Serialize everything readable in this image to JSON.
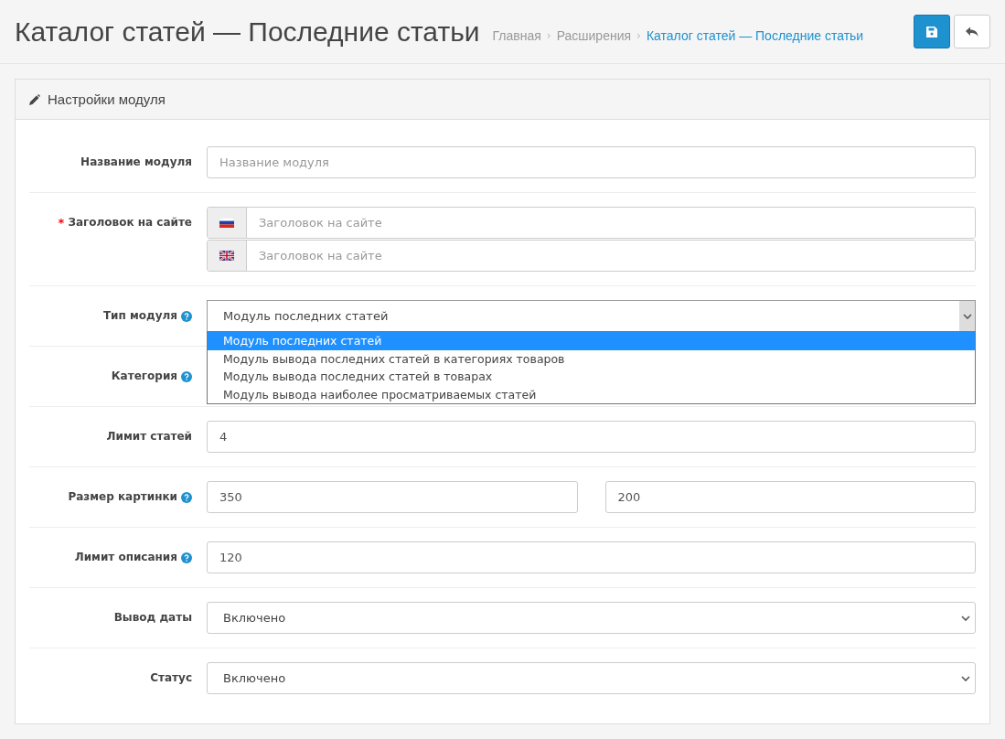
{
  "header": {
    "title": "Каталог статей — Последние статьи",
    "separator": "›",
    "breadcrumbs": [
      {
        "label": "Главная",
        "current": false
      },
      {
        "label": "Расширения",
        "current": false
      },
      {
        "label": "Каталог статей — Последние статьи",
        "current": true
      }
    ]
  },
  "panel": {
    "title": "Настройки модуля"
  },
  "rows": [
    {
      "kind": "input",
      "label": "Название модуля",
      "help": false,
      "placeholder": "Название модуля"
    },
    {
      "kind": "multilang",
      "label": "Заголовок на сайте",
      "required_mark": "*",
      "help": false,
      "fields": [
        {
          "kind": "ru",
          "placeholder": "Заголовок на сайте"
        },
        {
          "kind": "gb",
          "placeholder": "Заголовок на сайте"
        }
      ]
    },
    {
      "kind": "select_open",
      "label": "Тип модуля",
      "help": true,
      "value": "Модуль последних статей",
      "options": [
        {
          "label": "Модуль последних статей",
          "selected": true
        },
        {
          "label": "Модуль вывода последних статей в категориях товаров",
          "selected": false
        },
        {
          "label": "Модуль вывода последних статей в товарах",
          "selected": false
        },
        {
          "label": "Модуль вывода наиболее просматриваемых статей",
          "selected": false
        }
      ]
    },
    {
      "kind": "hidden",
      "label": "Категория",
      "help": true
    },
    {
      "kind": "input",
      "label": "Лимит статей",
      "help": false,
      "value": "4"
    },
    {
      "kind": "pair",
      "label": "Размер картинки",
      "help": true,
      "values": [
        "350",
        "200"
      ]
    },
    {
      "kind": "input",
      "label": "Лимит описания",
      "help": true,
      "value": "120"
    },
    {
      "kind": "select",
      "label": "Вывод даты",
      "help": false,
      "value": "Включено"
    },
    {
      "kind": "select",
      "label": "Статус",
      "help": false,
      "value": "Включено"
    }
  ]
}
